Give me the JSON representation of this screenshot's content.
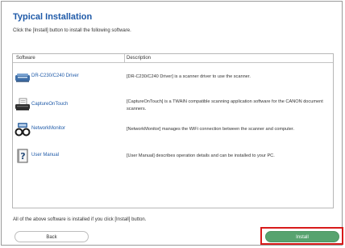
{
  "header": {
    "title": "Typical Installation",
    "instruction": "Click the [Install] button to install the following software."
  },
  "table": {
    "columns": [
      "Software",
      "Description"
    ],
    "rows": [
      {
        "icon": "scanner-icon",
        "name": "DR-C230/C240 Driver",
        "description": "[DR-C230/C240 Driver] is a scanner driver to use the scanner."
      },
      {
        "icon": "scan-document-icon",
        "name": "CaptureOnTouch",
        "description": "[CaptureOnTouch] is a TWAIN compatible scanning application software for the CANON document scanners."
      },
      {
        "icon": "network-monitor-icon",
        "name": "NetworkMonitor",
        "description": "[NetworkMonitor] manages the WiFi connection between the scanner and computer."
      },
      {
        "icon": "help-manual-icon",
        "name": "User Manual",
        "description": "[User Manual] describes operation details and can be installed to your PC."
      }
    ]
  },
  "footer": {
    "note": "All of the above software is installed if you click [Install] button.",
    "back_label": "Back",
    "install_label": "Install"
  },
  "colors": {
    "title": "#1f5aa8",
    "link": "#1f5aa8",
    "install_button": "#57a36f",
    "highlight": "#d81b1b"
  }
}
